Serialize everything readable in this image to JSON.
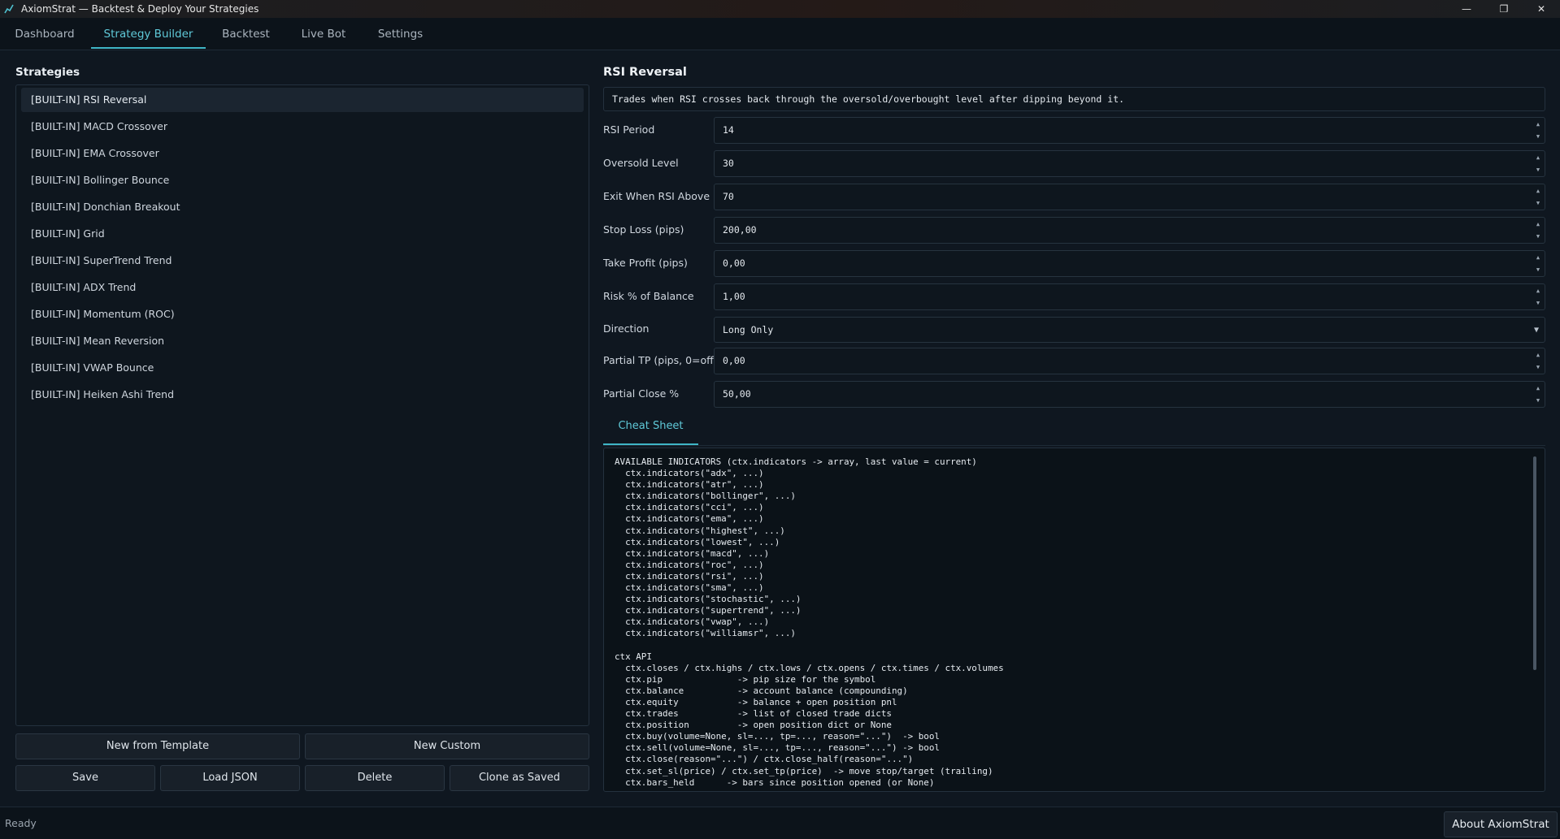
{
  "window": {
    "title": "AxiomStrat — Backtest & Deploy Your Strategies",
    "minimize": "—",
    "restore": "❐",
    "close": "✕"
  },
  "tabs": [
    "Dashboard",
    "Strategy Builder",
    "Backtest",
    "Live Bot",
    "Settings"
  ],
  "active_tab": "Strategy Builder",
  "strategies": {
    "title": "Strategies",
    "items": [
      "[BUILT-IN] RSI Reversal",
      "[BUILT-IN] MACD Crossover",
      "[BUILT-IN] EMA Crossover",
      "[BUILT-IN] Bollinger Bounce",
      "[BUILT-IN] Donchian Breakout",
      "[BUILT-IN] Grid",
      "[BUILT-IN] SuperTrend Trend",
      "[BUILT-IN] ADX Trend",
      "[BUILT-IN] Momentum (ROC)",
      "[BUILT-IN] Mean Reversion",
      "[BUILT-IN] VWAP Bounce",
      "[BUILT-IN] Heiken Ashi Trend"
    ],
    "selected": "[BUILT-IN] RSI Reversal"
  },
  "buttons": {
    "new_from_template": "New from Template",
    "new_custom": "New Custom",
    "save": "Save",
    "load_json": "Load JSON",
    "delete": "Delete",
    "clone_as_saved": "Clone as Saved"
  },
  "detail": {
    "title": "RSI Reversal",
    "description": "Trades when RSI crosses back through the oversold/overbought level after dipping beyond it.",
    "fields": [
      {
        "label": "RSI Period",
        "value": "14"
      },
      {
        "label": "Oversold Level",
        "value": "30"
      },
      {
        "label": "Exit When RSI Above",
        "value": "70"
      },
      {
        "label": "Stop Loss (pips)",
        "value": "200,00"
      },
      {
        "label": "Take Profit (pips)",
        "value": "0,00"
      },
      {
        "label": "Risk % of Balance",
        "value": "1,00"
      },
      {
        "label": "Direction",
        "value": "Long Only"
      },
      {
        "label": "Partial TP (pips, 0=off)",
        "value": "0,00"
      },
      {
        "label": "Partial Close %",
        "value": "50,00"
      }
    ]
  },
  "cheat_sheet": {
    "tab_label": "Cheat Sheet",
    "text": "AVAILABLE INDICATORS (ctx.indicators -> array, last value = current)\n  ctx.indicators(\"adx\", ...)\n  ctx.indicators(\"atr\", ...)\n  ctx.indicators(\"bollinger\", ...)\n  ctx.indicators(\"cci\", ...)\n  ctx.indicators(\"ema\", ...)\n  ctx.indicators(\"highest\", ...)\n  ctx.indicators(\"lowest\", ...)\n  ctx.indicators(\"macd\", ...)\n  ctx.indicators(\"roc\", ...)\n  ctx.indicators(\"rsi\", ...)\n  ctx.indicators(\"sma\", ...)\n  ctx.indicators(\"stochastic\", ...)\n  ctx.indicators(\"supertrend\", ...)\n  ctx.indicators(\"vwap\", ...)\n  ctx.indicators(\"williamsr\", ...)\n\nctx API\n  ctx.closes / ctx.highs / ctx.lows / ctx.opens / ctx.times / ctx.volumes\n  ctx.pip              -> pip size for the symbol\n  ctx.balance          -> account balance (compounding)\n  ctx.equity           -> balance + open position pnl\n  ctx.trades           -> list of closed trade dicts\n  ctx.position         -> open position dict or None\n  ctx.buy(volume=None, sl=..., tp=..., reason=\"...\")  -> bool\n  ctx.sell(volume=None, sl=..., tp=..., reason=\"...\") -> bool\n  ctx.close(reason=\"...\") / ctx.close_half(reason=\"...\")\n  ctx.set_sl(price) / ctx.set_tp(price)  -> move stop/target (trailing)\n  ctx.bars_held      -> bars since position opened (or None)"
  },
  "status": {
    "text": "Ready",
    "about_button": "About AxiomStrat"
  }
}
